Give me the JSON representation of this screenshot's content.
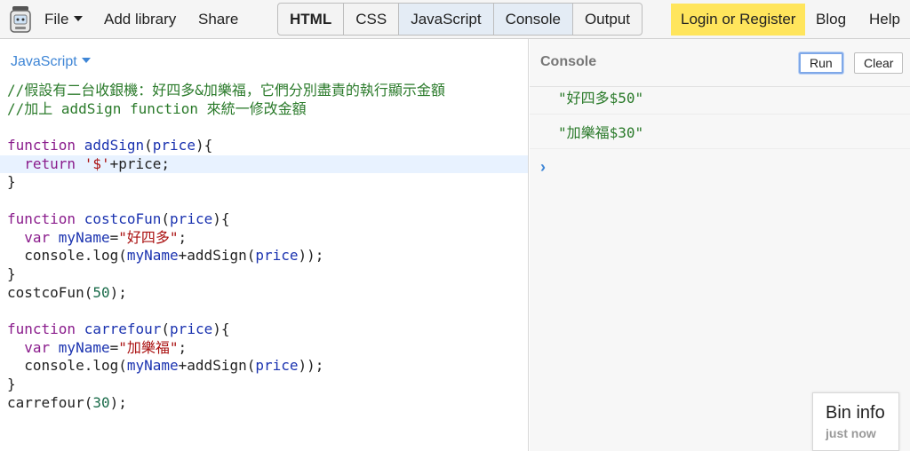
{
  "topbar": {
    "file_label": "File",
    "add_library_label": "Add library",
    "share_label": "Share",
    "tabs": [
      {
        "label": "HTML",
        "bold": true,
        "active": false
      },
      {
        "label": "CSS",
        "bold": false,
        "active": false
      },
      {
        "label": "JavaScript",
        "bold": false,
        "active": true
      },
      {
        "label": "Console",
        "bold": false,
        "active": true
      },
      {
        "label": "Output",
        "bold": false,
        "active": false
      }
    ],
    "login_label": "Login or Register",
    "blog_label": "Blog",
    "help_label": "Help"
  },
  "editor": {
    "language": "JavaScript",
    "active_line": 5,
    "lines": [
      [
        {
          "t": "//假設有二台收銀機：好四多&加樂福，它們分別盡責的執行顯示金額",
          "c": "comment"
        }
      ],
      [
        {
          "t": "//加上 addSign function 來統一修改金額",
          "c": "comment"
        }
      ],
      [],
      [
        {
          "t": "function ",
          "c": "keyword"
        },
        {
          "t": "addSign",
          "c": "def"
        },
        {
          "t": "(",
          "c": "plain"
        },
        {
          "t": "price",
          "c": "param"
        },
        {
          "t": "){",
          "c": "plain"
        }
      ],
      [
        {
          "t": "  ",
          "c": "plain"
        },
        {
          "t": "return ",
          "c": "keyword"
        },
        {
          "t": "'$'",
          "c": "string"
        },
        {
          "t": "+price;",
          "c": "plain"
        }
      ],
      [
        {
          "t": "}",
          "c": "plain"
        }
      ],
      [],
      [
        {
          "t": "function ",
          "c": "keyword"
        },
        {
          "t": "costcoFun",
          "c": "def"
        },
        {
          "t": "(",
          "c": "plain"
        },
        {
          "t": "price",
          "c": "param"
        },
        {
          "t": "){",
          "c": "plain"
        }
      ],
      [
        {
          "t": "  ",
          "c": "plain"
        },
        {
          "t": "var ",
          "c": "keyword"
        },
        {
          "t": "myName",
          "c": "var"
        },
        {
          "t": "=",
          "c": "plain"
        },
        {
          "t": "\"好四多\"",
          "c": "string"
        },
        {
          "t": ";",
          "c": "plain"
        }
      ],
      [
        {
          "t": "  console.log(",
          "c": "plain"
        },
        {
          "t": "myName",
          "c": "var"
        },
        {
          "t": "+addSign(",
          "c": "plain"
        },
        {
          "t": "price",
          "c": "param"
        },
        {
          "t": "));",
          "c": "plain"
        }
      ],
      [
        {
          "t": "}",
          "c": "plain"
        }
      ],
      [
        {
          "t": "costcoFun(",
          "c": "plain"
        },
        {
          "t": "50",
          "c": "number"
        },
        {
          "t": ");",
          "c": "plain"
        }
      ],
      [],
      [
        {
          "t": "function ",
          "c": "keyword"
        },
        {
          "t": "carrefour",
          "c": "def"
        },
        {
          "t": "(",
          "c": "plain"
        },
        {
          "t": "price",
          "c": "param"
        },
        {
          "t": "){",
          "c": "plain"
        }
      ],
      [
        {
          "t": "  ",
          "c": "plain"
        },
        {
          "t": "var ",
          "c": "keyword"
        },
        {
          "t": "myName",
          "c": "var"
        },
        {
          "t": "=",
          "c": "plain"
        },
        {
          "t": "\"加樂福\"",
          "c": "string"
        },
        {
          "t": ";",
          "c": "plain"
        }
      ],
      [
        {
          "t": "  console.log(",
          "c": "plain"
        },
        {
          "t": "myName",
          "c": "var"
        },
        {
          "t": "+addSign(",
          "c": "plain"
        },
        {
          "t": "price",
          "c": "param"
        },
        {
          "t": "));",
          "c": "plain"
        }
      ],
      [
        {
          "t": "}",
          "c": "plain"
        }
      ],
      [
        {
          "t": "carrefour(",
          "c": "plain"
        },
        {
          "t": "30",
          "c": "number"
        },
        {
          "t": ");",
          "c": "plain"
        }
      ]
    ]
  },
  "console": {
    "title": "Console",
    "run_label": "Run",
    "clear_label": "Clear",
    "outputs": [
      "\"好四多$50\"",
      "\"加樂福$30\""
    ],
    "prompt_symbol": "›"
  },
  "bin_info": {
    "title": "Bin info",
    "subtitle": "just now"
  },
  "colors": {
    "accent": "#3f86d6",
    "login_bg": "#ffe55c",
    "active_tab_bg": "#e4ecf5",
    "comment": "#2a7a2a",
    "keyword": "#8a1c8c",
    "string": "#aa1111"
  }
}
